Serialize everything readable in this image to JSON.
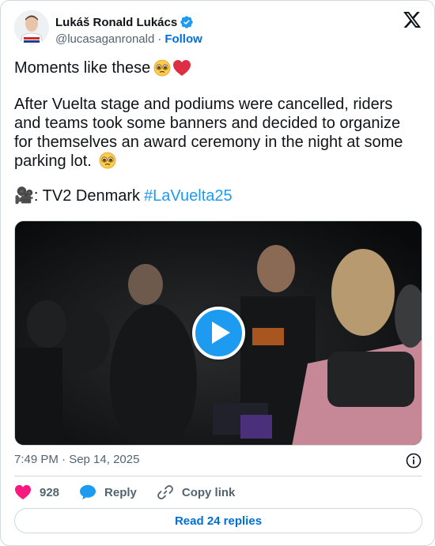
{
  "author": {
    "display_name": "Lukáš Ronald Lukács",
    "handle": "@lucasaganronald",
    "separator": "·",
    "follow_label": "Follow"
  },
  "tweet": {
    "line1": "Moments like these",
    "para2": "After Vuelta stage and podiums were cancelled, riders and teams took some banners and decided to organize for themselves an award ceremony in the night at some parking lot.",
    "para3_prefix": "🎥: TV2 Denmark",
    "hashtag": "#LaVuelta25"
  },
  "meta": {
    "timestamp": "7:49 PM · Sep 14, 2025"
  },
  "actions": {
    "like_count": "928",
    "reply_label": "Reply",
    "copy_label": "Copy link"
  },
  "footer": {
    "read_replies_label": "Read 24 replies"
  },
  "colors": {
    "accent": "#1d9bf0",
    "link": "#006fd6",
    "heart": "#f91880",
    "muted": "#536471"
  },
  "icons": [
    "verified-badge-icon",
    "x-logo-icon",
    "play-icon",
    "info-icon",
    "heart-icon",
    "reply-bubble-icon",
    "link-icon",
    "pleading-face-emoji",
    "red-heart-emoji"
  ]
}
